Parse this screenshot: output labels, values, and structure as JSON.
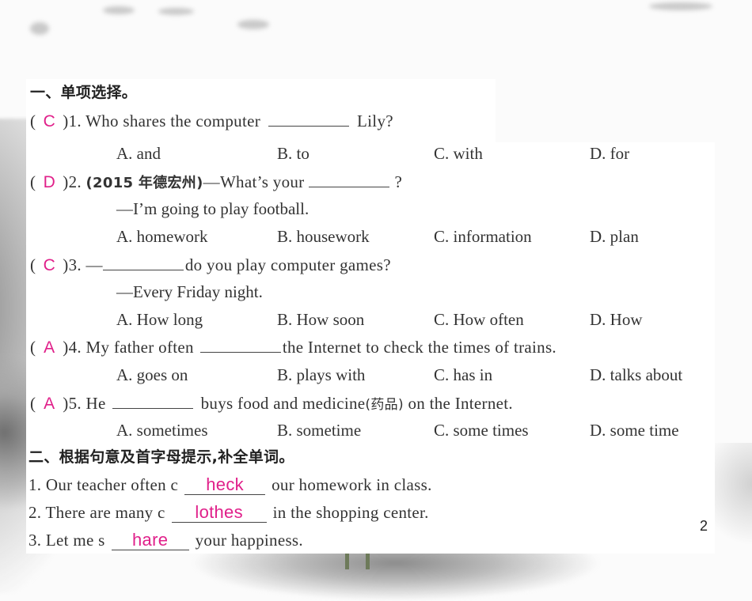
{
  "section1": {
    "heading": "一、单项选择。",
    "questions": [
      {
        "answer": "C",
        "number": ")1.",
        "stem_before": "Who shares the computer",
        "stem_after": "Lily?",
        "options": [
          "A. and",
          "B. to",
          "C. with",
          "D. for"
        ]
      },
      {
        "answer": "D",
        "number": ")2.",
        "source": "(2015 年德宏州)",
        "stem_before": "—What’s your",
        "stem_after": "?",
        "reply": "—I’m going to play football.",
        "options": [
          "A. homework",
          "B. housework",
          "C. information",
          "D. plan"
        ]
      },
      {
        "answer": "C",
        "number": ")3.",
        "stem_before": "—",
        "stem_after": "do you play computer games?",
        "reply": "—Every Friday night.",
        "options": [
          "A. How long",
          "B. How soon",
          "C. How often",
          "D. How"
        ]
      },
      {
        "answer": "A",
        "number": ")4.",
        "stem_before": "My father often",
        "stem_after": "the Internet to check the times of trains.",
        "options": [
          "A. goes on",
          "B. plays with",
          "C. has in",
          "D. talks about"
        ]
      },
      {
        "answer": "A",
        "number": ")5.",
        "stem_before": "He",
        "stem_after_en1": "buys food and medicine",
        "stem_after_cn": "(药品)",
        "stem_after_en2": " on the Internet.",
        "options": [
          "A. sometimes",
          "B. sometime",
          "C. some times",
          "D. some time"
        ]
      }
    ]
  },
  "section2": {
    "heading": "二、根据句意及首字母提示,补全单词。",
    "items": [
      {
        "before": "1. Our teacher often c",
        "fill": "heck",
        "after": "our homework in class."
      },
      {
        "before": "2. There are many c",
        "fill": "lothes",
        "after": "in the shopping center."
      },
      {
        "before": "3. Let me s",
        "fill": "hare",
        "after": "your happiness."
      }
    ]
  },
  "paren_open": "(",
  "page_number": "2",
  "colors": {
    "answer": "#e0208a",
    "text": "#333333"
  }
}
